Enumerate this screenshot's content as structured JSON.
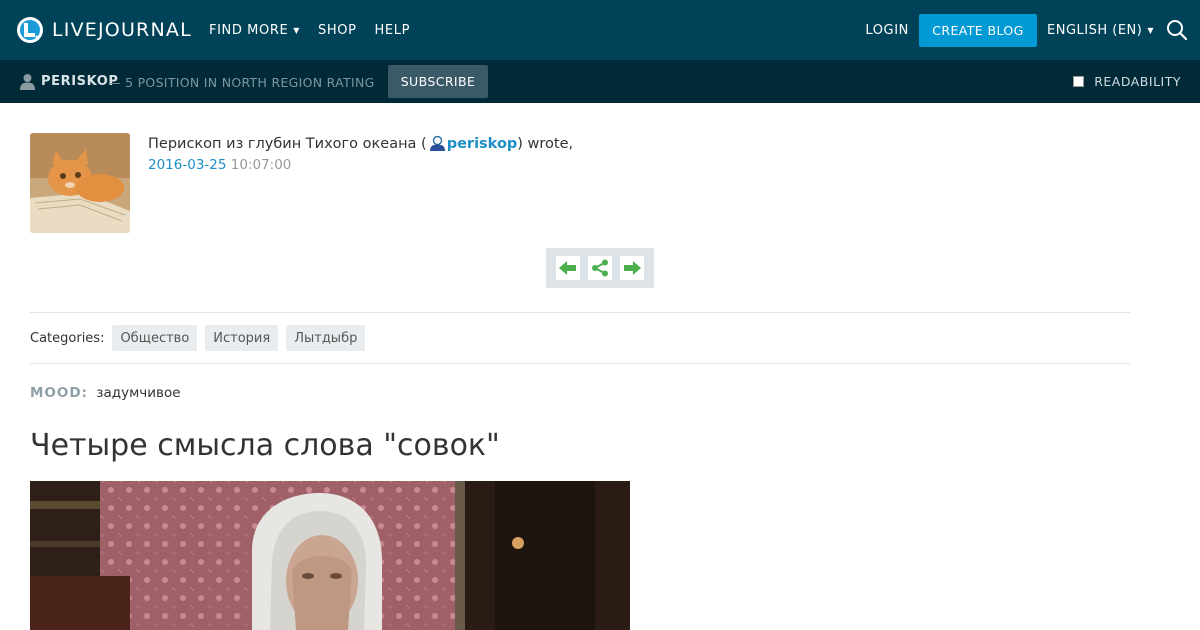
{
  "header": {
    "logo_text": "LIVEJOURNAL",
    "nav": [
      {
        "label": "FIND MORE",
        "has_caret": true
      },
      {
        "label": "SHOP",
        "has_caret": false
      },
      {
        "label": "HELP",
        "has_caret": false
      }
    ],
    "login_label": "LOGIN",
    "create_blog_label": "CREATE BLOG",
    "language_label": "ENGLISH (EN)",
    "colors": {
      "bar": "#004359",
      "accent": "#0399d4"
    }
  },
  "subbar": {
    "journal_name": "PERISKOP",
    "rating_text": "— 5 POSITION IN NORTH REGION RATING",
    "subscribe_label": "SUBSCRIBE",
    "readability_label": "READABILITY"
  },
  "post": {
    "author_prefix": "Перископ из глубин Тихого океана (",
    "author_username": "periskop",
    "author_suffix": ") wrote,",
    "date": "2016-03-25",
    "time": "10:07:00",
    "categories_label": "Categories:",
    "categories": [
      "Общество",
      "История",
      "Лытдыбр"
    ],
    "mood_label": "MOOD:",
    "mood_value": "задумчивое",
    "title": "Четыре смысла слова \"совок\""
  }
}
